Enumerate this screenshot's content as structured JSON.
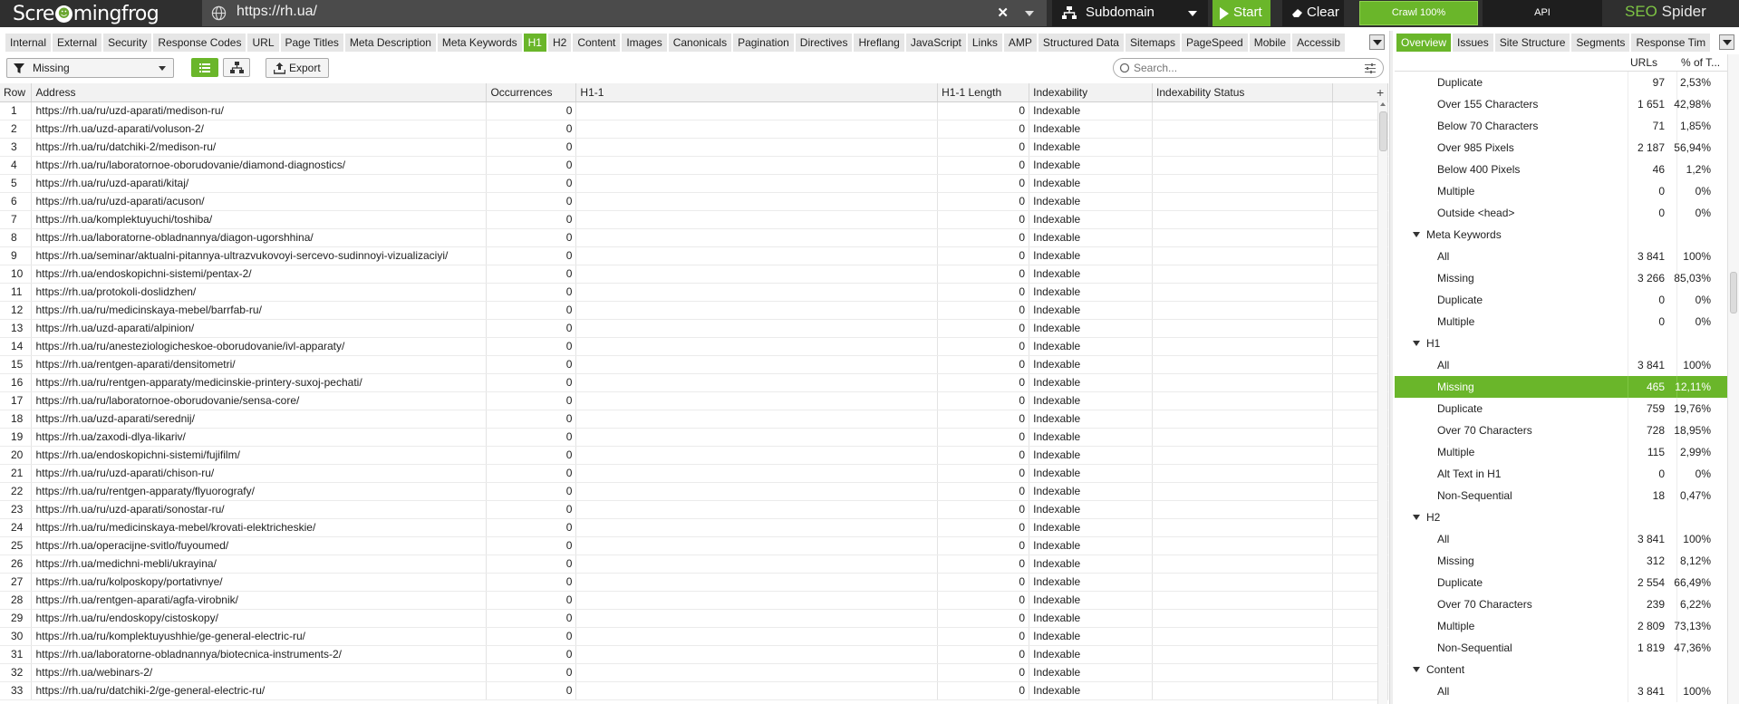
{
  "app": {
    "logo_text_left": "Scre",
    "logo_text_right": "mingfrog",
    "url": "https://rh.ua/",
    "clear_url_symbol": "✕",
    "mode": "Subdomain",
    "start_label": "Start",
    "clear_label": "Clear",
    "crawl_label": "Crawl 100%",
    "crawl_progress": 1.0,
    "api_label": "API",
    "brand_seo": "SEO",
    "brand_spider": " Spider",
    "accent_color": "#6ab62a"
  },
  "tabs": [
    {
      "label": "Internal"
    },
    {
      "label": "External"
    },
    {
      "label": "Security"
    },
    {
      "label": "Response Codes"
    },
    {
      "label": "URL"
    },
    {
      "label": "Page Titles"
    },
    {
      "label": "Meta Description"
    },
    {
      "label": "Meta Keywords"
    },
    {
      "label": "H1",
      "active": true
    },
    {
      "label": "H2"
    },
    {
      "label": "Content"
    },
    {
      "label": "Images"
    },
    {
      "label": "Canonicals"
    },
    {
      "label": "Pagination"
    },
    {
      "label": "Directives"
    },
    {
      "label": "Hreflang"
    },
    {
      "label": "JavaScript"
    },
    {
      "label": "Links"
    },
    {
      "label": "AMP"
    },
    {
      "label": "Structured Data"
    },
    {
      "label": "Sitemaps"
    },
    {
      "label": "PageSpeed"
    },
    {
      "label": "Mobile"
    },
    {
      "label": "Accessib"
    }
  ],
  "right_tabs": [
    {
      "label": "Overview",
      "active": true
    },
    {
      "label": "Issues"
    },
    {
      "label": "Site Structure"
    },
    {
      "label": "Segments"
    },
    {
      "label": "Response Tim"
    }
  ],
  "filter": {
    "value": "Missing",
    "export_label": "Export",
    "search_placeholder": "Search..."
  },
  "table": {
    "columns": [
      "Row",
      "Address",
      "Occurrences",
      "H1-1",
      "H1-1 Length",
      "Indexability",
      "Indexability Status"
    ],
    "rows": [
      [
        "1",
        "https://rh.ua/ru/uzd-aparati/medison-ru/",
        "0",
        "",
        "0",
        "Indexable",
        ""
      ],
      [
        "2",
        "https://rh.ua/uzd-aparati/voluson-2/",
        "0",
        "",
        "0",
        "Indexable",
        ""
      ],
      [
        "3",
        "https://rh.ua/ru/datchiki-2/medison-ru/",
        "0",
        "",
        "0",
        "Indexable",
        ""
      ],
      [
        "4",
        "https://rh.ua/ru/laboratornoe-oborudovanie/diamond-diagnostics/",
        "0",
        "",
        "0",
        "Indexable",
        ""
      ],
      [
        "5",
        "https://rh.ua/ru/uzd-aparati/kitaj/",
        "0",
        "",
        "0",
        "Indexable",
        ""
      ],
      [
        "6",
        "https://rh.ua/ru/uzd-aparati/acuson/",
        "0",
        "",
        "0",
        "Indexable",
        ""
      ],
      [
        "7",
        "https://rh.ua/komplektuyuchi/toshiba/",
        "0",
        "",
        "0",
        "Indexable",
        ""
      ],
      [
        "8",
        "https://rh.ua/laboratorne-obladnannya/diagon-ugorshhina/",
        "0",
        "",
        "0",
        "Indexable",
        ""
      ],
      [
        "9",
        "https://rh.ua/seminar/aktualni-pitannya-ultrazvukovoyi-sercevo-sudinnoyi-vizualizaciyi/",
        "0",
        "",
        "0",
        "Indexable",
        ""
      ],
      [
        "10",
        "https://rh.ua/endoskopichni-sistemi/pentax-2/",
        "0",
        "",
        "0",
        "Indexable",
        ""
      ],
      [
        "11",
        "https://rh.ua/protokoli-doslidzhen/",
        "0",
        "",
        "0",
        "Indexable",
        ""
      ],
      [
        "12",
        "https://rh.ua/ru/medicinskaya-mebel/barrfab-ru/",
        "0",
        "",
        "0",
        "Indexable",
        ""
      ],
      [
        "13",
        "https://rh.ua/uzd-aparati/alpinion/",
        "0",
        "",
        "0",
        "Indexable",
        ""
      ],
      [
        "14",
        "https://rh.ua/ru/anesteziologicheskoe-oborudovanie/ivl-apparaty/",
        "0",
        "",
        "0",
        "Indexable",
        ""
      ],
      [
        "15",
        "https://rh.ua/rentgen-aparati/densitometri/",
        "0",
        "",
        "0",
        "Indexable",
        ""
      ],
      [
        "16",
        "https://rh.ua/ru/rentgen-apparaty/medicinskie-printery-suxoj-pechati/",
        "0",
        "",
        "0",
        "Indexable",
        ""
      ],
      [
        "17",
        "https://rh.ua/ru/laboratornoe-oborudovanie/sensa-core/",
        "0",
        "",
        "0",
        "Indexable",
        ""
      ],
      [
        "18",
        "https://rh.ua/uzd-aparati/serednij/",
        "0",
        "",
        "0",
        "Indexable",
        ""
      ],
      [
        "19",
        "https://rh.ua/zaxodi-dlya-likariv/",
        "0",
        "",
        "0",
        "Indexable",
        ""
      ],
      [
        "20",
        "https://rh.ua/endoskopichni-sistemi/fujifilm/",
        "0",
        "",
        "0",
        "Indexable",
        ""
      ],
      [
        "21",
        "https://rh.ua/ru/uzd-aparati/chison-ru/",
        "0",
        "",
        "0",
        "Indexable",
        ""
      ],
      [
        "22",
        "https://rh.ua/ru/rentgen-apparaty/flyuorografy/",
        "0",
        "",
        "0",
        "Indexable",
        ""
      ],
      [
        "23",
        "https://rh.ua/ru/uzd-aparati/sonostar-ru/",
        "0",
        "",
        "0",
        "Indexable",
        ""
      ],
      [
        "24",
        "https://rh.ua/ru/medicinskaya-mebel/krovati-elektricheskie/",
        "0",
        "",
        "0",
        "Indexable",
        ""
      ],
      [
        "25",
        "https://rh.ua/operacijne-svitlo/fuyoumed/",
        "0",
        "",
        "0",
        "Indexable",
        ""
      ],
      [
        "26",
        "https://rh.ua/medichni-mebli/ukrayina/",
        "0",
        "",
        "0",
        "Indexable",
        ""
      ],
      [
        "27",
        "https://rh.ua/ru/kolposkopy/portativnye/",
        "0",
        "",
        "0",
        "Indexable",
        ""
      ],
      [
        "28",
        "https://rh.ua/rentgen-aparati/agfa-virobnik/",
        "0",
        "",
        "0",
        "Indexable",
        ""
      ],
      [
        "29",
        "https://rh.ua/ru/endoskopy/cistoskopy/",
        "0",
        "",
        "0",
        "Indexable",
        ""
      ],
      [
        "30",
        "https://rh.ua/ru/komplektuyushhie/ge-general-electric-ru/",
        "0",
        "",
        "0",
        "Indexable",
        ""
      ],
      [
        "31",
        "https://rh.ua/laboratorne-obladnannya/biotecnica-instruments-2/",
        "0",
        "",
        "0",
        "Indexable",
        ""
      ],
      [
        "32",
        "https://rh.ua/webinars-2/",
        "0",
        "",
        "0",
        "Indexable",
        ""
      ],
      [
        "33",
        "https://rh.ua/ru/datchiki-2/ge-general-electric-ru/",
        "0",
        "",
        "0",
        "Indexable",
        ""
      ]
    ]
  },
  "overview": {
    "header": {
      "urls": "URLs",
      "pct": "% of T..."
    },
    "rows": [
      {
        "label": "Duplicate",
        "urls": "97",
        "pct": "2,53%"
      },
      {
        "label": "Over 155 Characters",
        "urls": "1 651",
        "pct": "42,98%"
      },
      {
        "label": "Below 70 Characters",
        "urls": "71",
        "pct": "1,85%"
      },
      {
        "label": "Over 985 Pixels",
        "urls": "2 187",
        "pct": "56,94%"
      },
      {
        "label": "Below 400 Pixels",
        "urls": "46",
        "pct": "1,2%"
      },
      {
        "label": "Multiple",
        "urls": "0",
        "pct": "0%"
      },
      {
        "label": "Outside <head>",
        "urls": "0",
        "pct": "0%"
      },
      {
        "label": "Meta Keywords",
        "group": true
      },
      {
        "label": "All",
        "urls": "3 841",
        "pct": "100%"
      },
      {
        "label": "Missing",
        "urls": "3 266",
        "pct": "85,03%"
      },
      {
        "label": "Duplicate",
        "urls": "0",
        "pct": "0%"
      },
      {
        "label": "Multiple",
        "urls": "0",
        "pct": "0%"
      },
      {
        "label": "H1",
        "group": true
      },
      {
        "label": "All",
        "urls": "3 841",
        "pct": "100%"
      },
      {
        "label": "Missing",
        "urls": "465",
        "pct": "12,11%",
        "selected": true
      },
      {
        "label": "Duplicate",
        "urls": "759",
        "pct": "19,76%"
      },
      {
        "label": "Over 70 Characters",
        "urls": "728",
        "pct": "18,95%"
      },
      {
        "label": "Multiple",
        "urls": "115",
        "pct": "2,99%"
      },
      {
        "label": "Alt Text in H1",
        "urls": "0",
        "pct": "0%"
      },
      {
        "label": "Non-Sequential",
        "urls": "18",
        "pct": "0,47%"
      },
      {
        "label": "H2",
        "group": true
      },
      {
        "label": "All",
        "urls": "3 841",
        "pct": "100%"
      },
      {
        "label": "Missing",
        "urls": "312",
        "pct": "8,12%"
      },
      {
        "label": "Duplicate",
        "urls": "2 554",
        "pct": "66,49%"
      },
      {
        "label": "Over 70 Characters",
        "urls": "239",
        "pct": "6,22%"
      },
      {
        "label": "Multiple",
        "urls": "2 809",
        "pct": "73,13%"
      },
      {
        "label": "Non-Sequential",
        "urls": "1 819",
        "pct": "47,36%"
      },
      {
        "label": "Content",
        "group": true
      },
      {
        "label": "All",
        "urls": "3 841",
        "pct": "100%"
      }
    ]
  }
}
